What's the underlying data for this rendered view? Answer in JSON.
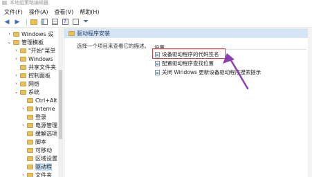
{
  "window": {
    "title": "本地组策略编辑器"
  },
  "menu": [
    "文件(F)",
    "操作(A)",
    "查看(V)",
    "帮助(H)"
  ],
  "toolbar": [
    "back-icon",
    "forward-icon",
    "folder-up-icon",
    "show-hide-tree-icon",
    "properties-icon",
    "help-icon",
    "view-icon",
    "filter-icon"
  ],
  "tree": [
    {
      "label": "Windows 设",
      "arrow": "›",
      "depth": 1
    },
    {
      "label": "管理模板",
      "arrow": "⌄",
      "depth": 1
    },
    {
      "label": "\"开始\"菜单",
      "arrow": "›",
      "depth": 2
    },
    {
      "label": "Windows",
      "arrow": "›",
      "depth": 2
    },
    {
      "label": "共享文件夹",
      "arrow": "",
      "depth": 2
    },
    {
      "label": "控制面板",
      "arrow": "›",
      "depth": 2
    },
    {
      "label": "网络",
      "arrow": "›",
      "depth": 2
    },
    {
      "label": "系统",
      "arrow": "⌄",
      "depth": 2
    },
    {
      "label": "Ctrl+Alt",
      "arrow": "",
      "depth": 3
    },
    {
      "label": "Interne",
      "arrow": "›",
      "depth": 3
    },
    {
      "label": "登录",
      "arrow": "",
      "depth": 3
    },
    {
      "label": "电源管理",
      "arrow": "›",
      "depth": 3
    },
    {
      "label": "缓解选项",
      "arrow": "",
      "depth": 3
    },
    {
      "label": "脚本",
      "arrow": "",
      "depth": 3
    },
    {
      "label": "可移动",
      "arrow": "",
      "depth": 3
    },
    {
      "label": "区域设置",
      "arrow": "",
      "depth": 3
    },
    {
      "label": "驱动程",
      "arrow": "",
      "depth": 3,
      "selected": true
    },
    {
      "label": "文件夹",
      "arrow": "›",
      "depth": 3
    }
  ],
  "pane": {
    "header": "驱动程序安装",
    "description": "选择一个项目来查看它的描述。",
    "column": "设置",
    "items": [
      "设备驱动程序的代码签名",
      "配置驱动程序查找位置",
      "关闭 Windows 更新设备驱动程序搜索提示"
    ]
  },
  "colors": {
    "highlight": "#e23b3b",
    "annotation_arrow": "#8b3fb0",
    "header_bg": "#d7e4f3"
  }
}
